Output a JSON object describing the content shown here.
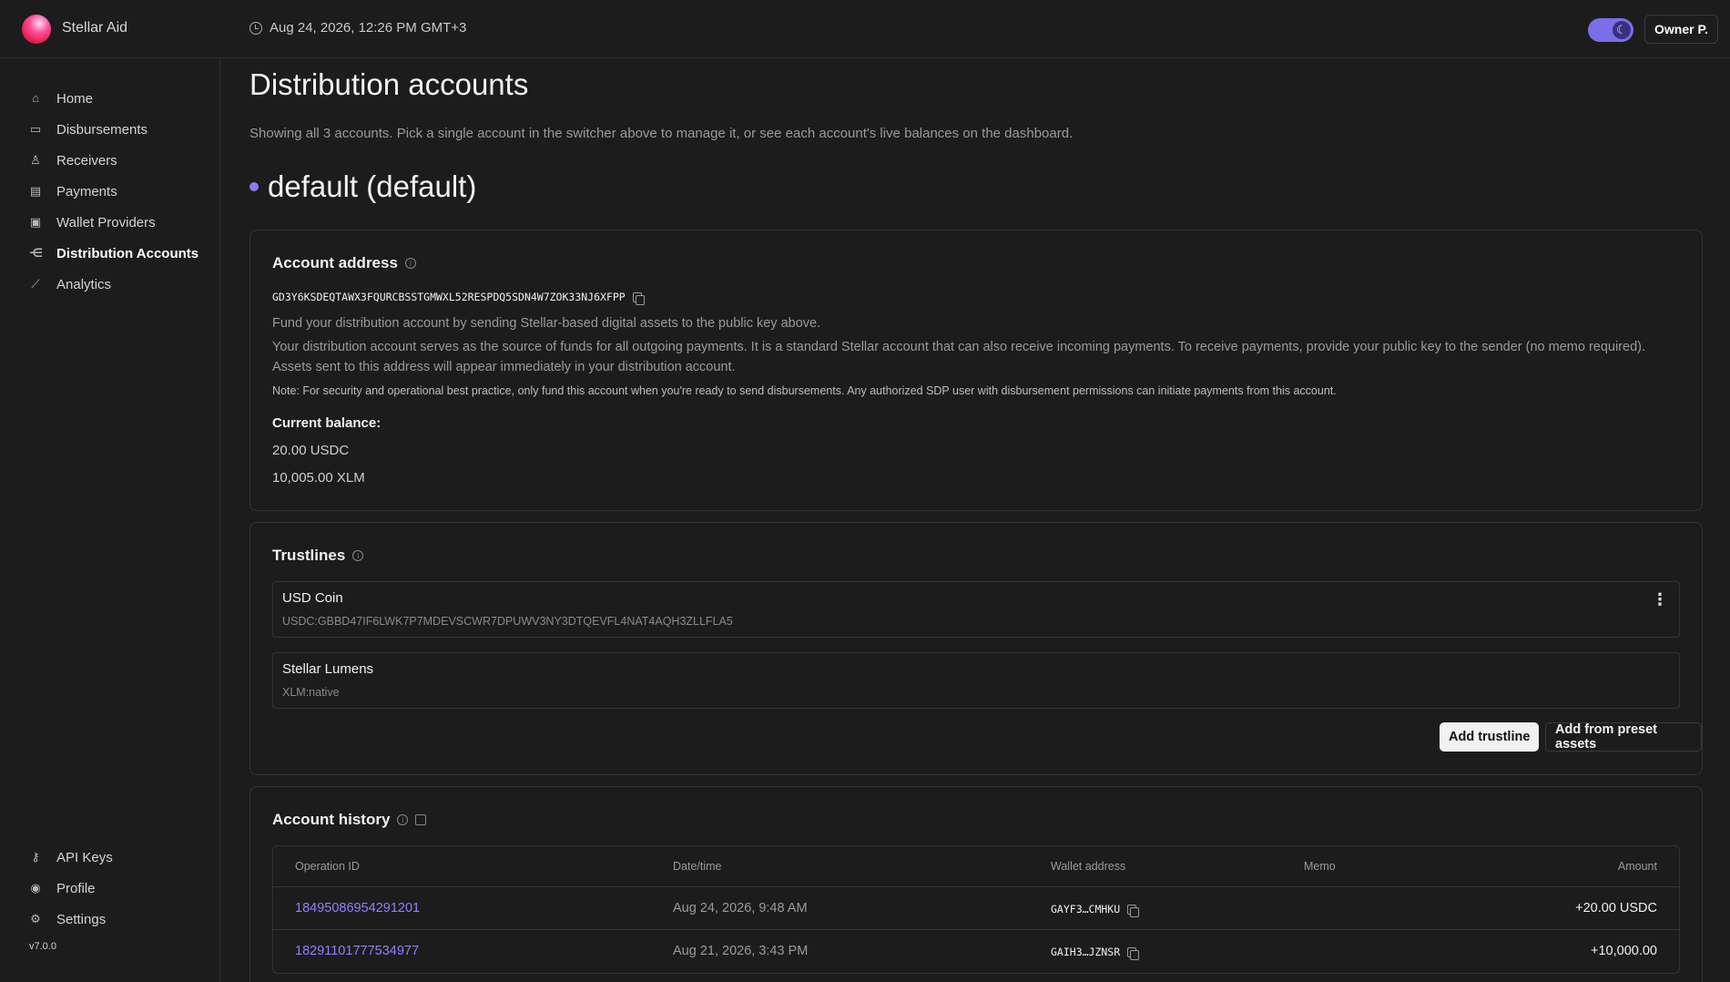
{
  "header": {
    "brand": "Stellar Aid",
    "datetime": "Aug 24, 2026, 12:26 PM GMT+3",
    "user": "Owner P.",
    "accent_color": "#7b6ee8"
  },
  "sidebar": {
    "items": [
      {
        "label": "Home",
        "icon": "home-icon"
      },
      {
        "label": "Disbursements",
        "icon": "inbox-icon"
      },
      {
        "label": "Receivers",
        "icon": "users-icon"
      },
      {
        "label": "Payments",
        "icon": "payments-icon"
      },
      {
        "label": "Wallet Providers",
        "icon": "wallet-icon"
      },
      {
        "label": "Distribution Accounts",
        "icon": "distribution-icon",
        "active": true
      },
      {
        "label": "Analytics",
        "icon": "chart-icon"
      }
    ],
    "bottom_items": [
      {
        "label": "API Keys",
        "icon": "key-icon"
      },
      {
        "label": "Profile",
        "icon": "user-circle-icon"
      },
      {
        "label": "Settings",
        "icon": "gear-icon"
      }
    ],
    "version": "v7.0.0"
  },
  "main": {
    "title": "Distribution accounts",
    "subtitle": "Showing all 3 accounts. Pick a single account in the switcher above to manage it, or see each account's live balances on the dashboard.",
    "account_heading": "default (default)"
  },
  "address_card": {
    "title": "Account address",
    "address": "GD3Y6KSDEQTAWX3FQURCBSSTGMWXL52RESPDQ5SDN4W7ZOK33NJ6XFPP",
    "fund_text": "Fund your distribution account by sending Stellar-based digital assets to the public key above.",
    "desc_text": "Your distribution account serves as the source of funds for all outgoing payments. It is a standard Stellar account that can also receive incoming payments. To receive payments, provide your public key to the sender (no memo required). Assets sent to this address will appear immediately in your distribution account.",
    "note": "Note: For security and operational best practice, only fund this account when you're ready to send disbursements. Any authorized SDP user with disbursement permissions can initiate payments from this account.",
    "balance_label": "Current balance:",
    "balances": [
      "20.00 USDC",
      "10,005.00 XLM"
    ]
  },
  "trustlines": {
    "title": "Trustlines",
    "items": [
      {
        "name": "USD Coin",
        "code": "USDC:GBBD47IF6LWK7P7MDEVSCWR7DPUWV3NY3DTQEVFL4NAT4AQH3ZLLFLA5"
      },
      {
        "name": "Stellar Lumens",
        "code": "XLM:native"
      }
    ],
    "add_button": "Add trustline",
    "preset_button": "Add from preset assets"
  },
  "history": {
    "title": "Account history",
    "columns": [
      "Operation ID",
      "Date/time",
      "Wallet address",
      "Memo",
      "Amount"
    ],
    "rows": [
      {
        "id": "18495086954291201",
        "date": "Aug 24, 2026, 9:48 AM",
        "wallet": "GAYF3…CMHKU",
        "memo": "",
        "amount": "+20.00 USDC"
      },
      {
        "id": "18291101777534977",
        "date": "Aug 21, 2026, 3:43 PM",
        "wallet": "GAIH3…JZNSR",
        "memo": "",
        "amount": "+10,000.00"
      }
    ]
  }
}
